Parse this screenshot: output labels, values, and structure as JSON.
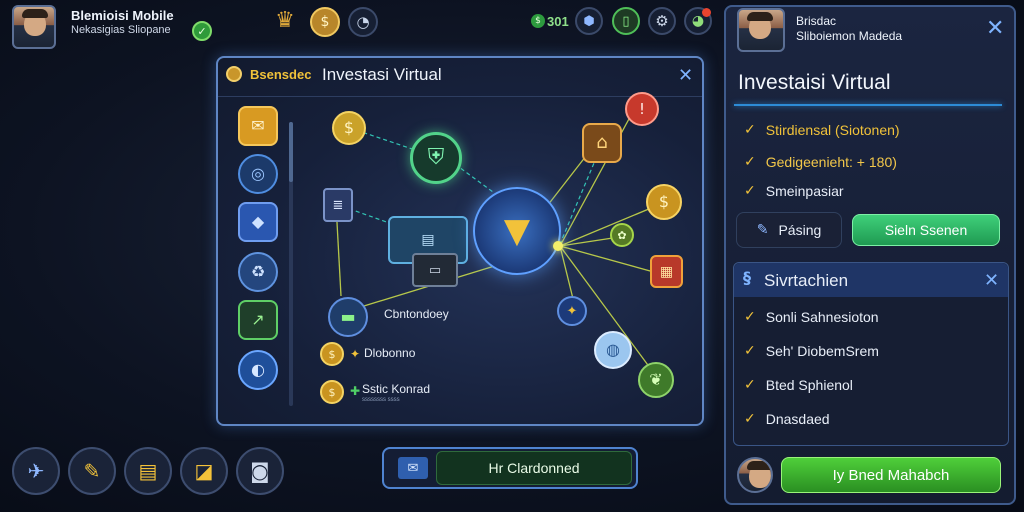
{
  "profile": {
    "name": "Blemioisi Mobile",
    "subtitle": "Nekasigias Sliopane"
  },
  "top_status": {
    "counter": "301"
  },
  "modal": {
    "tag": "Bsensdec",
    "title": "Investasi Virtual",
    "labels": {
      "center": "Cbntondoey",
      "item1": "Dlobonno",
      "item2": "Sstic Konrad",
      "item2_sub": "ssssssss ssss"
    }
  },
  "right_panel": {
    "user_line1": "Brisdac",
    "user_line2": "Sliboiemon Madeda",
    "title": "Investaisi Virtual",
    "checklist": [
      {
        "text": "Stirdiensal (Siotonen)",
        "color": "#f0c23a"
      },
      {
        "text": "Gedigeenieht: + 180)",
        "color": "#f2c74a"
      },
      {
        "text": "Smeinpasiar",
        "color": "#e8eef8"
      }
    ],
    "posting_label": "Pásing",
    "green_button_label": "Sieln Ssenen",
    "section2": {
      "title": "Sivrtachien",
      "items": [
        "Sonli Sahnesioton",
        "Seh' DiobemSrem",
        "Bted Sphienol",
        "Dnasdaed"
      ]
    },
    "bottom_button_label": "Iy Bned Mahabch"
  },
  "bottom_bar": {
    "center_button_label": "Hr Clardonned"
  }
}
